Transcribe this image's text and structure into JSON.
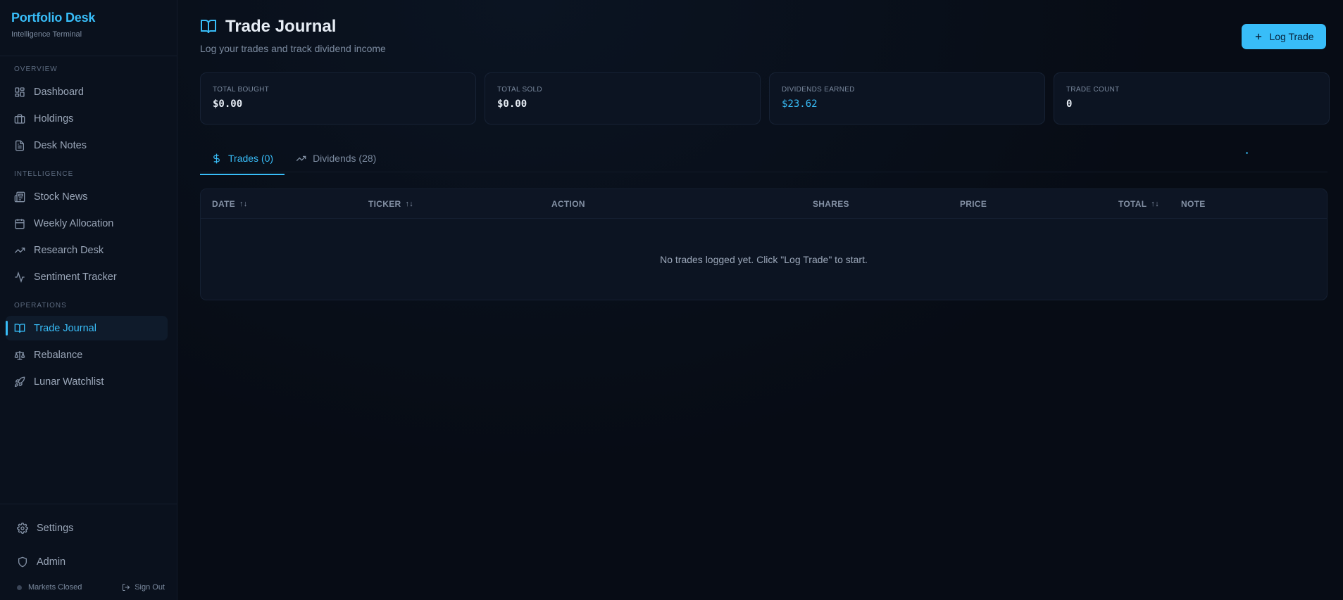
{
  "brand": {
    "title": "Portfolio Desk",
    "subtitle": "Intelligence Terminal"
  },
  "sidebar": {
    "sections": [
      {
        "label": "OVERVIEW"
      },
      {
        "label": "INTELLIGENCE"
      },
      {
        "label": "OPERATIONS"
      }
    ],
    "items": [
      {
        "label": "Dashboard",
        "icon": "dashboard-icon"
      },
      {
        "label": "Holdings",
        "icon": "briefcase-icon"
      },
      {
        "label": "Desk Notes",
        "icon": "file-text-icon"
      },
      {
        "label": "Stock News",
        "icon": "newspaper-icon"
      },
      {
        "label": "Weekly Allocation",
        "icon": "calendar-icon"
      },
      {
        "label": "Research Desk",
        "icon": "trending-up-icon"
      },
      {
        "label": "Sentiment Tracker",
        "icon": "activity-icon"
      },
      {
        "label": "Trade Journal",
        "icon": "book-open-icon",
        "active": true
      },
      {
        "label": "Rebalance",
        "icon": "scale-icon"
      },
      {
        "label": "Lunar Watchlist",
        "icon": "rocket-icon"
      }
    ],
    "bottom": [
      {
        "label": "Settings",
        "icon": "gear-icon"
      },
      {
        "label": "Admin",
        "icon": "shield-icon"
      }
    ],
    "market_status": "Markets Closed",
    "sign_out": "Sign Out"
  },
  "header": {
    "title": "Trade Journal",
    "subtitle": "Log your trades and track dividend income",
    "log_button": "Log Trade"
  },
  "cards": [
    {
      "label": "TOTAL BOUGHT",
      "value": "$0.00"
    },
    {
      "label": "TOTAL SOLD",
      "value": "$0.00"
    },
    {
      "label": "DIVIDENDS EARNED",
      "value": "$23.62"
    },
    {
      "label": "TRADE COUNT",
      "value": "0"
    }
  ],
  "tabs": [
    {
      "label": "Trades (0)",
      "active": true
    },
    {
      "label": "Dividends (28)"
    }
  ],
  "table": {
    "columns": [
      "DATE",
      "TICKER",
      "ACTION",
      "SHARES",
      "PRICE",
      "TOTAL",
      "NOTE"
    ],
    "sort_glyph": "↑↓",
    "empty_message": "No trades logged yet. Click \"Log Trade\" to start."
  },
  "colors": {
    "accent": "#38bdf8",
    "background": "#070c15",
    "sidebar": "#0a111d"
  }
}
